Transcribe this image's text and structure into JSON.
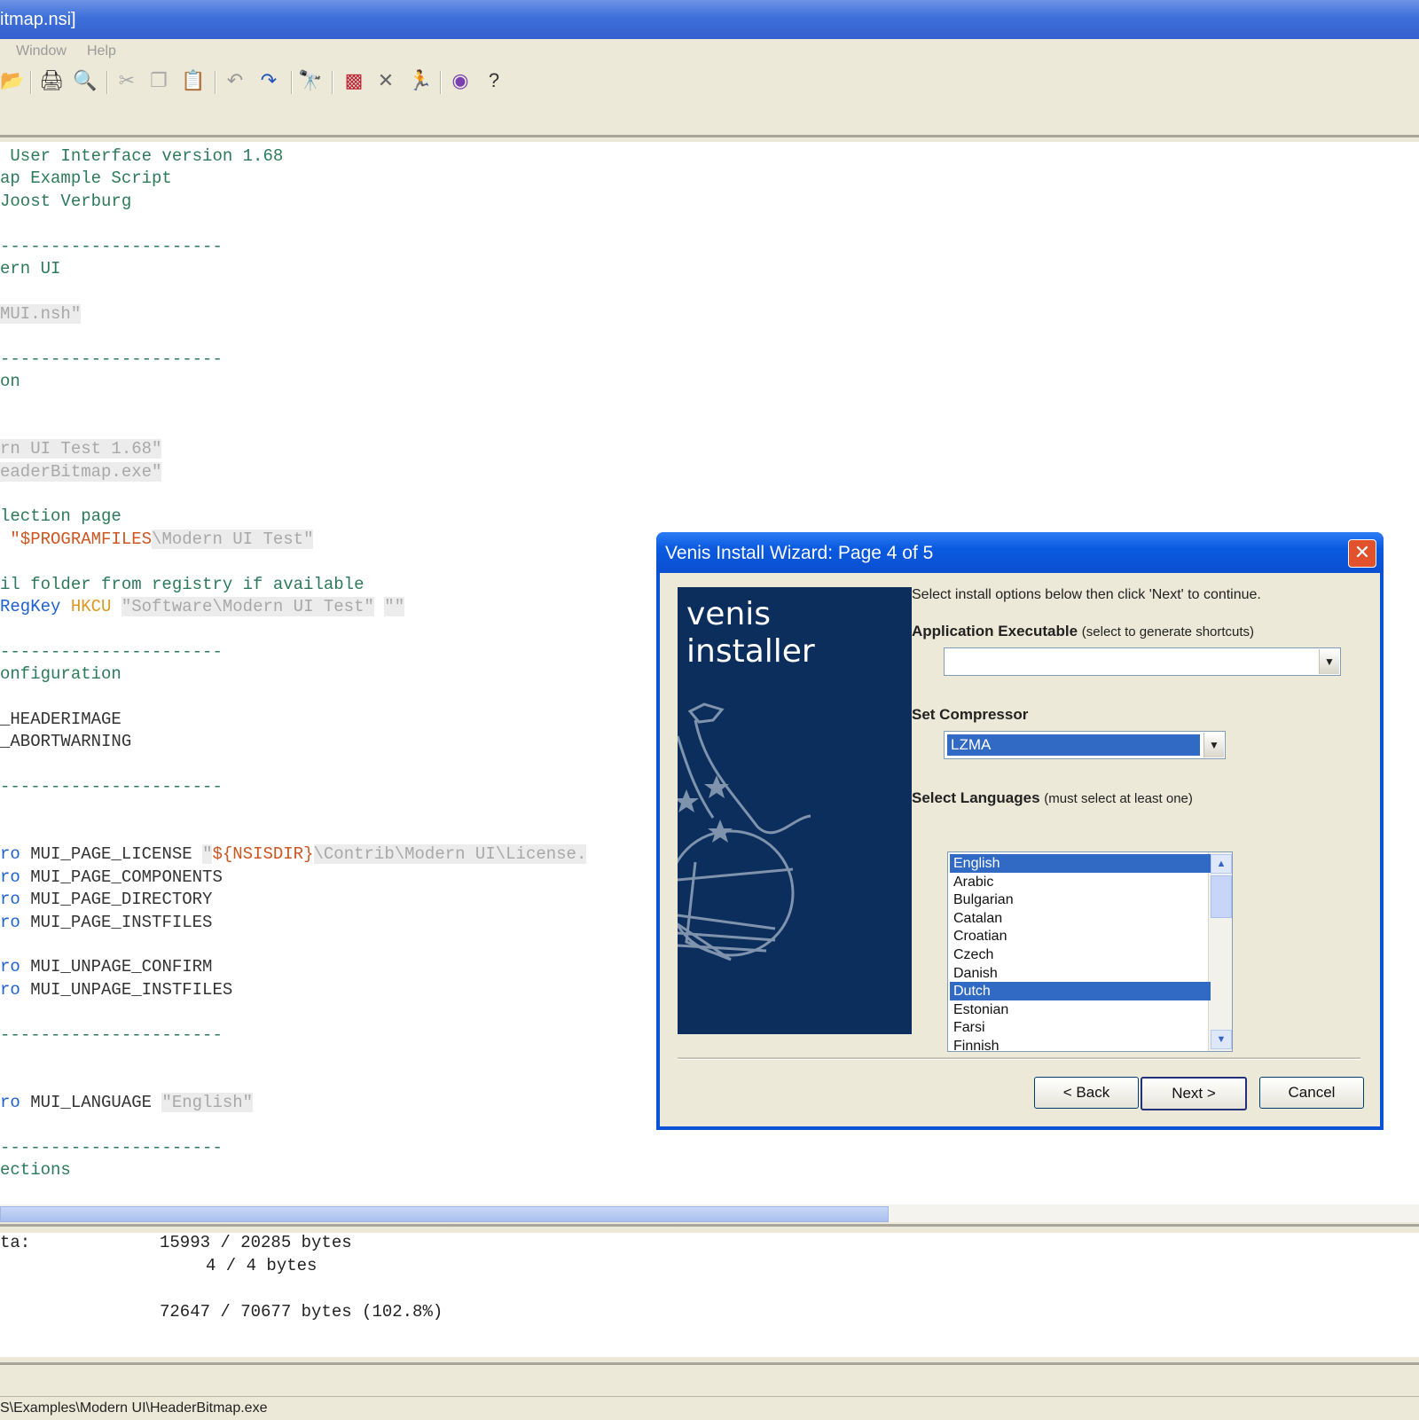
{
  "window": {
    "title": "itmap.nsi]",
    "menu": [
      "Window",
      "Help"
    ]
  },
  "toolbar_icons": [
    "open-icon",
    "print-icon",
    "print-preview-icon",
    "cut-icon",
    "copy-icon",
    "paste-icon",
    "undo-icon",
    "redo-icon",
    "find-icon",
    "compile-icon",
    "stop-icon",
    "run-icon",
    "settings-icon",
    "help-icon"
  ],
  "editor": {
    "lines": [
      {
        "segments": [
          {
            "t": " User Interface version 1.68",
            "c": "green"
          }
        ]
      },
      {
        "segments": [
          {
            "t": "ap Example Script",
            "c": "green"
          }
        ]
      },
      {
        "segments": [
          {
            "t": "Joost Verburg",
            "c": "green"
          }
        ]
      },
      {
        "segments": []
      },
      {
        "segments": [
          {
            "t": "----------------------",
            "c": "green"
          }
        ]
      },
      {
        "segments": [
          {
            "t": "ern UI",
            "c": "green"
          }
        ]
      },
      {
        "segments": []
      },
      {
        "segments": [
          {
            "t": "MUI.nsh\"",
            "c": "str"
          }
        ]
      },
      {
        "segments": []
      },
      {
        "segments": [
          {
            "t": "----------------------",
            "c": "green"
          }
        ]
      },
      {
        "segments": [
          {
            "t": "on",
            "c": "green"
          }
        ]
      },
      {
        "segments": []
      },
      {
        "segments": []
      },
      {
        "segments": [
          {
            "t": "rn UI Test 1.68\"",
            "c": "str"
          }
        ]
      },
      {
        "segments": [
          {
            "t": "eaderBitmap.exe\"",
            "c": "str"
          }
        ]
      },
      {
        "segments": []
      },
      {
        "segments": [
          {
            "t": "lection page",
            "c": "green"
          }
        ]
      },
      {
        "segments": [
          {
            "t": " ",
            "c": "dark"
          },
          {
            "t": "\"$PROGRAMFILES",
            "c": "var"
          },
          {
            "t": "\\Modern UI Test\"",
            "c": "str"
          }
        ]
      },
      {
        "segments": []
      },
      {
        "segments": [
          {
            "t": "il folder from registry if available",
            "c": "green"
          }
        ]
      },
      {
        "segments": [
          {
            "t": "RegKey ",
            "c": "blue"
          },
          {
            "t": "HKCU ",
            "c": "orange"
          },
          {
            "t": "\"Software\\Modern UI Test\"",
            "c": "str"
          },
          {
            "t": " ",
            "c": "dark"
          },
          {
            "t": "\"\"",
            "c": "str"
          }
        ]
      },
      {
        "segments": []
      },
      {
        "segments": [
          {
            "t": "----------------------",
            "c": "green"
          }
        ]
      },
      {
        "segments": [
          {
            "t": "onfiguration",
            "c": "green"
          }
        ]
      },
      {
        "segments": []
      },
      {
        "segments": [
          {
            "t": "_HEADERIMAGE",
            "c": "dark"
          }
        ]
      },
      {
        "segments": [
          {
            "t": "_ABORTWARNING",
            "c": "dark"
          }
        ]
      },
      {
        "segments": []
      },
      {
        "segments": [
          {
            "t": "----------------------",
            "c": "green"
          }
        ]
      },
      {
        "segments": []
      },
      {
        "segments": []
      },
      {
        "segments": [
          {
            "t": "ro ",
            "c": "blue"
          },
          {
            "t": "MUI_PAGE_LICENSE ",
            "c": "dark"
          },
          {
            "t": "\"",
            "c": "str"
          },
          {
            "t": "${NSISDIR}",
            "c": "var"
          },
          {
            "t": "\\Contrib\\Modern UI\\License.",
            "c": "str"
          }
        ]
      },
      {
        "segments": [
          {
            "t": "ro ",
            "c": "blue"
          },
          {
            "t": "MUI_PAGE_COMPONENTS",
            "c": "dark"
          }
        ]
      },
      {
        "segments": [
          {
            "t": "ro ",
            "c": "blue"
          },
          {
            "t": "MUI_PAGE_DIRECTORY",
            "c": "dark"
          }
        ]
      },
      {
        "segments": [
          {
            "t": "ro ",
            "c": "blue"
          },
          {
            "t": "MUI_PAGE_INSTFILES",
            "c": "dark"
          }
        ]
      },
      {
        "segments": []
      },
      {
        "segments": [
          {
            "t": "ro ",
            "c": "blue"
          },
          {
            "t": "MUI_UNPAGE_CONFIRM",
            "c": "dark"
          }
        ]
      },
      {
        "segments": [
          {
            "t": "ro ",
            "c": "blue"
          },
          {
            "t": "MUI_UNPAGE_INSTFILES",
            "c": "dark"
          }
        ]
      },
      {
        "segments": []
      },
      {
        "segments": [
          {
            "t": "----------------------",
            "c": "green"
          }
        ]
      },
      {
        "segments": []
      },
      {
        "segments": []
      },
      {
        "segments": [
          {
            "t": "ro ",
            "c": "blue"
          },
          {
            "t": "MUI_LANGUAGE ",
            "c": "dark"
          },
          {
            "t": "\"English\"",
            "c": "str"
          }
        ]
      },
      {
        "segments": []
      },
      {
        "segments": [
          {
            "t": "----------------------",
            "c": "green"
          }
        ]
      },
      {
        "segments": [
          {
            "t": "ections",
            "c": "green"
          }
        ]
      }
    ]
  },
  "output": {
    "line1_label": "ta:",
    "line1_value": "15993 / 20285 bytes",
    "line2_value": "4 / 4 bytes",
    "line3_value": "72647 / 70677 bytes (102.8%)"
  },
  "status": {
    "path": "S\\Examples\\Modern UI\\HeaderBitmap.exe"
  },
  "dialog": {
    "title": "Venis Install Wizard: Page 4 of 5",
    "close": "✕",
    "banner_line1": "venis",
    "banner_line2": "installer",
    "intro": "Select install options below then click 'Next' to continue.",
    "app_exe_label": "Application Executable",
    "app_exe_hint": "(select to generate shortcuts)",
    "app_exe_value": "",
    "compressor_label": "Set Compressor",
    "compressor_value": "LZMA",
    "languages_label": "Select Languages",
    "languages_hint": "(must select at least one)",
    "languages": [
      {
        "name": "English",
        "selected": true
      },
      {
        "name": "Arabic",
        "selected": false
      },
      {
        "name": "Bulgarian",
        "selected": false
      },
      {
        "name": "Catalan",
        "selected": false
      },
      {
        "name": "Croatian",
        "selected": false
      },
      {
        "name": "Czech",
        "selected": false
      },
      {
        "name": "Danish",
        "selected": false
      },
      {
        "name": "Dutch",
        "selected": true
      },
      {
        "name": "Estonian",
        "selected": false
      },
      {
        "name": "Farsi",
        "selected": false
      },
      {
        "name": "Finnish",
        "selected": false
      }
    ],
    "back_label": "< Back",
    "next_label": "Next >",
    "cancel_label": "Cancel"
  }
}
